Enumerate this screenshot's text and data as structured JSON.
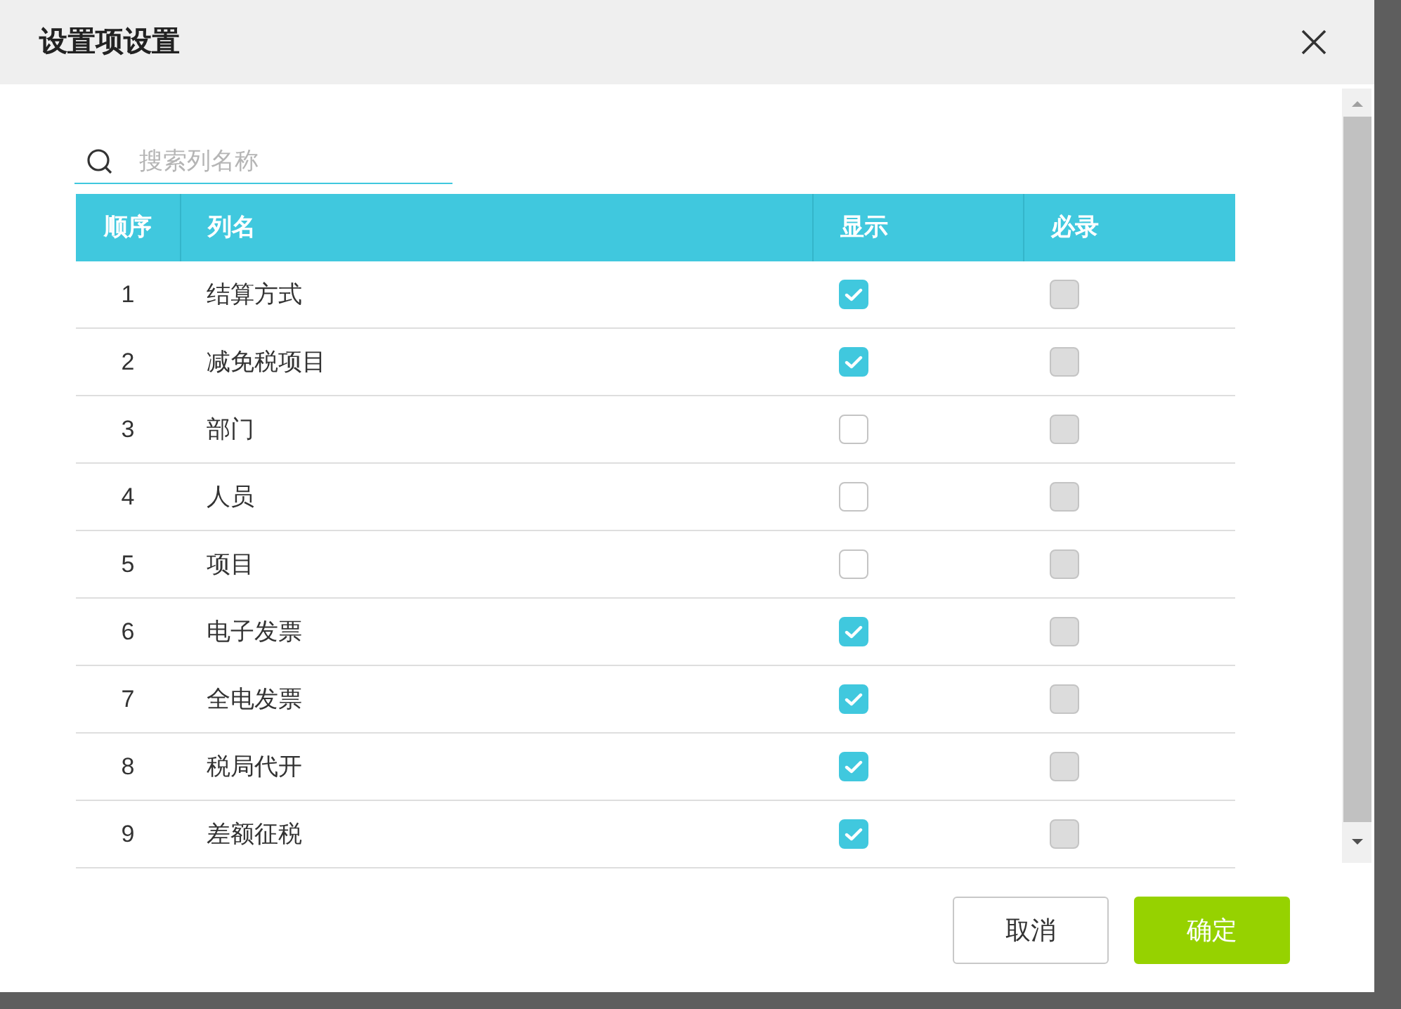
{
  "dialog": {
    "title": "设置项设置"
  },
  "search": {
    "placeholder": "搜索列名称"
  },
  "table": {
    "columns": [
      "顺序",
      "列名",
      "显示",
      "必录"
    ],
    "rows": [
      {
        "order": "1",
        "name": "结算方式",
        "show": true,
        "required": false,
        "required_disabled": true
      },
      {
        "order": "2",
        "name": "减免税项目",
        "show": true,
        "required": false,
        "required_disabled": true
      },
      {
        "order": "3",
        "name": "部门",
        "show": false,
        "required": false,
        "required_disabled": true
      },
      {
        "order": "4",
        "name": "人员",
        "show": false,
        "required": false,
        "required_disabled": true
      },
      {
        "order": "5",
        "name": "项目",
        "show": false,
        "required": false,
        "required_disabled": true
      },
      {
        "order": "6",
        "name": "电子发票",
        "show": true,
        "required": false,
        "required_disabled": true
      },
      {
        "order": "7",
        "name": "全电发票",
        "show": true,
        "required": false,
        "required_disabled": true
      },
      {
        "order": "8",
        "name": "税局代开",
        "show": true,
        "required": false,
        "required_disabled": true
      },
      {
        "order": "9",
        "name": "差额征税",
        "show": true,
        "required": false,
        "required_disabled": true
      }
    ]
  },
  "buttons": [
    {
      "label": "取消",
      "kind": "secondary"
    },
    {
      "label": "确定",
      "kind": "primary"
    }
  ]
}
